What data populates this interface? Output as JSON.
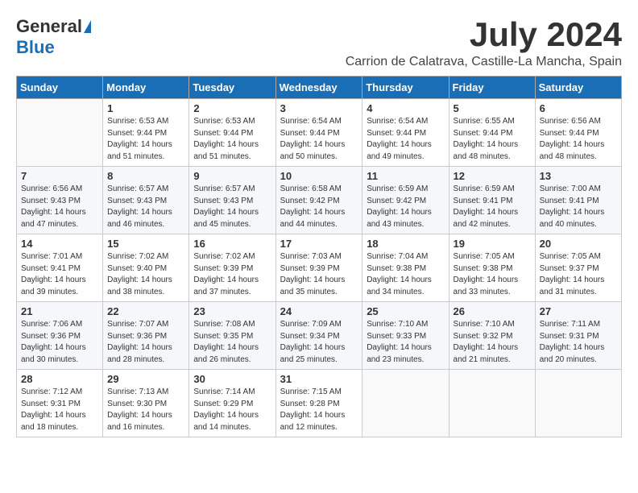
{
  "header": {
    "logo_general": "General",
    "logo_blue": "Blue",
    "month_year": "July 2024",
    "location": "Carrion de Calatrava, Castille-La Mancha, Spain"
  },
  "weekdays": [
    "Sunday",
    "Monday",
    "Tuesday",
    "Wednesday",
    "Thursday",
    "Friday",
    "Saturday"
  ],
  "weeks": [
    [
      {
        "day": "",
        "sunrise": "",
        "sunset": "",
        "daylight": ""
      },
      {
        "day": "1",
        "sunrise": "Sunrise: 6:53 AM",
        "sunset": "Sunset: 9:44 PM",
        "daylight": "Daylight: 14 hours and 51 minutes."
      },
      {
        "day": "2",
        "sunrise": "Sunrise: 6:53 AM",
        "sunset": "Sunset: 9:44 PM",
        "daylight": "Daylight: 14 hours and 51 minutes."
      },
      {
        "day": "3",
        "sunrise": "Sunrise: 6:54 AM",
        "sunset": "Sunset: 9:44 PM",
        "daylight": "Daylight: 14 hours and 50 minutes."
      },
      {
        "day": "4",
        "sunrise": "Sunrise: 6:54 AM",
        "sunset": "Sunset: 9:44 PM",
        "daylight": "Daylight: 14 hours and 49 minutes."
      },
      {
        "day": "5",
        "sunrise": "Sunrise: 6:55 AM",
        "sunset": "Sunset: 9:44 PM",
        "daylight": "Daylight: 14 hours and 48 minutes."
      },
      {
        "day": "6",
        "sunrise": "Sunrise: 6:56 AM",
        "sunset": "Sunset: 9:44 PM",
        "daylight": "Daylight: 14 hours and 48 minutes."
      }
    ],
    [
      {
        "day": "7",
        "sunrise": "Sunrise: 6:56 AM",
        "sunset": "Sunset: 9:43 PM",
        "daylight": "Daylight: 14 hours and 47 minutes."
      },
      {
        "day": "8",
        "sunrise": "Sunrise: 6:57 AM",
        "sunset": "Sunset: 9:43 PM",
        "daylight": "Daylight: 14 hours and 46 minutes."
      },
      {
        "day": "9",
        "sunrise": "Sunrise: 6:57 AM",
        "sunset": "Sunset: 9:43 PM",
        "daylight": "Daylight: 14 hours and 45 minutes."
      },
      {
        "day": "10",
        "sunrise": "Sunrise: 6:58 AM",
        "sunset": "Sunset: 9:42 PM",
        "daylight": "Daylight: 14 hours and 44 minutes."
      },
      {
        "day": "11",
        "sunrise": "Sunrise: 6:59 AM",
        "sunset": "Sunset: 9:42 PM",
        "daylight": "Daylight: 14 hours and 43 minutes."
      },
      {
        "day": "12",
        "sunrise": "Sunrise: 6:59 AM",
        "sunset": "Sunset: 9:41 PM",
        "daylight": "Daylight: 14 hours and 42 minutes."
      },
      {
        "day": "13",
        "sunrise": "Sunrise: 7:00 AM",
        "sunset": "Sunset: 9:41 PM",
        "daylight": "Daylight: 14 hours and 40 minutes."
      }
    ],
    [
      {
        "day": "14",
        "sunrise": "Sunrise: 7:01 AM",
        "sunset": "Sunset: 9:41 PM",
        "daylight": "Daylight: 14 hours and 39 minutes."
      },
      {
        "day": "15",
        "sunrise": "Sunrise: 7:02 AM",
        "sunset": "Sunset: 9:40 PM",
        "daylight": "Daylight: 14 hours and 38 minutes."
      },
      {
        "day": "16",
        "sunrise": "Sunrise: 7:02 AM",
        "sunset": "Sunset: 9:39 PM",
        "daylight": "Daylight: 14 hours and 37 minutes."
      },
      {
        "day": "17",
        "sunrise": "Sunrise: 7:03 AM",
        "sunset": "Sunset: 9:39 PM",
        "daylight": "Daylight: 14 hours and 35 minutes."
      },
      {
        "day": "18",
        "sunrise": "Sunrise: 7:04 AM",
        "sunset": "Sunset: 9:38 PM",
        "daylight": "Daylight: 14 hours and 34 minutes."
      },
      {
        "day": "19",
        "sunrise": "Sunrise: 7:05 AM",
        "sunset": "Sunset: 9:38 PM",
        "daylight": "Daylight: 14 hours and 33 minutes."
      },
      {
        "day": "20",
        "sunrise": "Sunrise: 7:05 AM",
        "sunset": "Sunset: 9:37 PM",
        "daylight": "Daylight: 14 hours and 31 minutes."
      }
    ],
    [
      {
        "day": "21",
        "sunrise": "Sunrise: 7:06 AM",
        "sunset": "Sunset: 9:36 PM",
        "daylight": "Daylight: 14 hours and 30 minutes."
      },
      {
        "day": "22",
        "sunrise": "Sunrise: 7:07 AM",
        "sunset": "Sunset: 9:36 PM",
        "daylight": "Daylight: 14 hours and 28 minutes."
      },
      {
        "day": "23",
        "sunrise": "Sunrise: 7:08 AM",
        "sunset": "Sunset: 9:35 PM",
        "daylight": "Daylight: 14 hours and 26 minutes."
      },
      {
        "day": "24",
        "sunrise": "Sunrise: 7:09 AM",
        "sunset": "Sunset: 9:34 PM",
        "daylight": "Daylight: 14 hours and 25 minutes."
      },
      {
        "day": "25",
        "sunrise": "Sunrise: 7:10 AM",
        "sunset": "Sunset: 9:33 PM",
        "daylight": "Daylight: 14 hours and 23 minutes."
      },
      {
        "day": "26",
        "sunrise": "Sunrise: 7:10 AM",
        "sunset": "Sunset: 9:32 PM",
        "daylight": "Daylight: 14 hours and 21 minutes."
      },
      {
        "day": "27",
        "sunrise": "Sunrise: 7:11 AM",
        "sunset": "Sunset: 9:31 PM",
        "daylight": "Daylight: 14 hours and 20 minutes."
      }
    ],
    [
      {
        "day": "28",
        "sunrise": "Sunrise: 7:12 AM",
        "sunset": "Sunset: 9:31 PM",
        "daylight": "Daylight: 14 hours and 18 minutes."
      },
      {
        "day": "29",
        "sunrise": "Sunrise: 7:13 AM",
        "sunset": "Sunset: 9:30 PM",
        "daylight": "Daylight: 14 hours and 16 minutes."
      },
      {
        "day": "30",
        "sunrise": "Sunrise: 7:14 AM",
        "sunset": "Sunset: 9:29 PM",
        "daylight": "Daylight: 14 hours and 14 minutes."
      },
      {
        "day": "31",
        "sunrise": "Sunrise: 7:15 AM",
        "sunset": "Sunset: 9:28 PM",
        "daylight": "Daylight: 14 hours and 12 minutes."
      },
      {
        "day": "",
        "sunrise": "",
        "sunset": "",
        "daylight": ""
      },
      {
        "day": "",
        "sunrise": "",
        "sunset": "",
        "daylight": ""
      },
      {
        "day": "",
        "sunrise": "",
        "sunset": "",
        "daylight": ""
      }
    ]
  ]
}
